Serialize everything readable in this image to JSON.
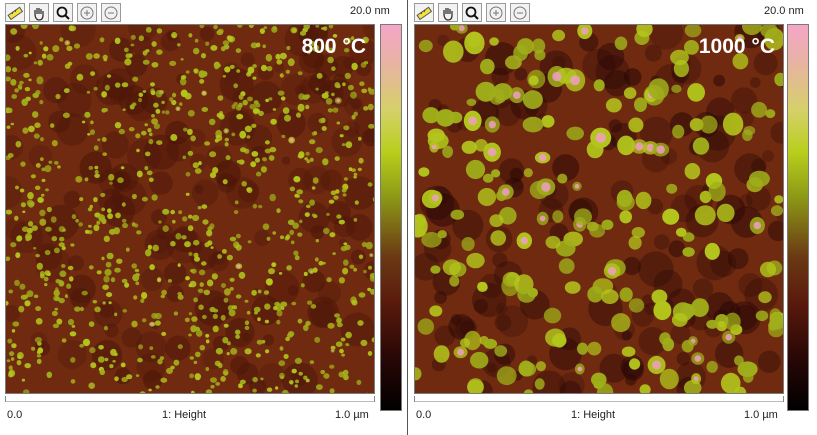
{
  "colors": {
    "substrate": "#6f2a10",
    "grain": "#b3c51c",
    "grain_peak": "#ef9fc0",
    "background": "#ffffff"
  },
  "toolbar": {
    "icons": [
      "ruler-icon",
      "hand-pan-icon",
      "magnifier-icon",
      "zoom-in-icon",
      "zoom-out-icon"
    ]
  },
  "panels": [
    {
      "temperature": "800 °C",
      "scale_max": "20.0 nm",
      "axis_start": "0.0",
      "axis_mid": "1: Height",
      "axis_end": "1.0 µm"
    },
    {
      "temperature": "1000 °C",
      "scale_max": "20.0 nm",
      "axis_start": "0.0",
      "axis_mid": "1: Height",
      "axis_end": "1.0 µm"
    }
  ]
}
